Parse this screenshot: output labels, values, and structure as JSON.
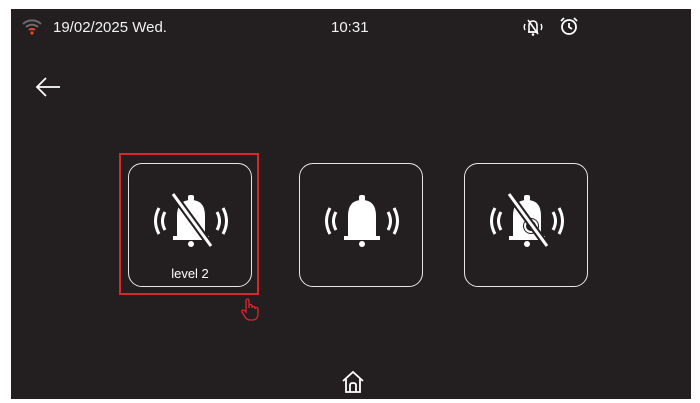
{
  "status_bar": {
    "date": "19/02/2025 Wed.",
    "time": "10:31",
    "wifi_color": "#e8452c"
  },
  "modes": [
    {
      "icon": "bell-off-icon",
      "label": "level 2",
      "selected": true
    },
    {
      "icon": "bell-ringing-icon",
      "label": "",
      "selected": false
    },
    {
      "icon": "bell-off-timer-icon",
      "label": "",
      "selected": false
    }
  ],
  "colors": {
    "background": "#231f20",
    "foreground": "#ffffff",
    "selection": "#d9262b"
  }
}
